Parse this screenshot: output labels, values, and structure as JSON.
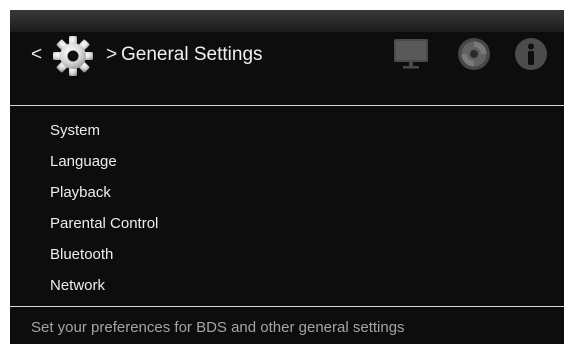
{
  "header": {
    "back_symbol": "<",
    "separator": ">",
    "title": "General Settings",
    "icons": [
      "gear-icon",
      "monitor-icon",
      "disc-icon",
      "info-icon"
    ]
  },
  "menu": {
    "items": [
      {
        "label": "System"
      },
      {
        "label": "Language"
      },
      {
        "label": "Playback"
      },
      {
        "label": "Parental Control"
      },
      {
        "label": "Bluetooth"
      },
      {
        "label": "Network"
      }
    ]
  },
  "footer": {
    "help_text": "Set your preferences for BDS and other general settings"
  },
  "colors": {
    "background": "#0d0d0d",
    "text": "#ededed",
    "help_text": "#a4a4a4",
    "divider": "#d8d8d8"
  }
}
